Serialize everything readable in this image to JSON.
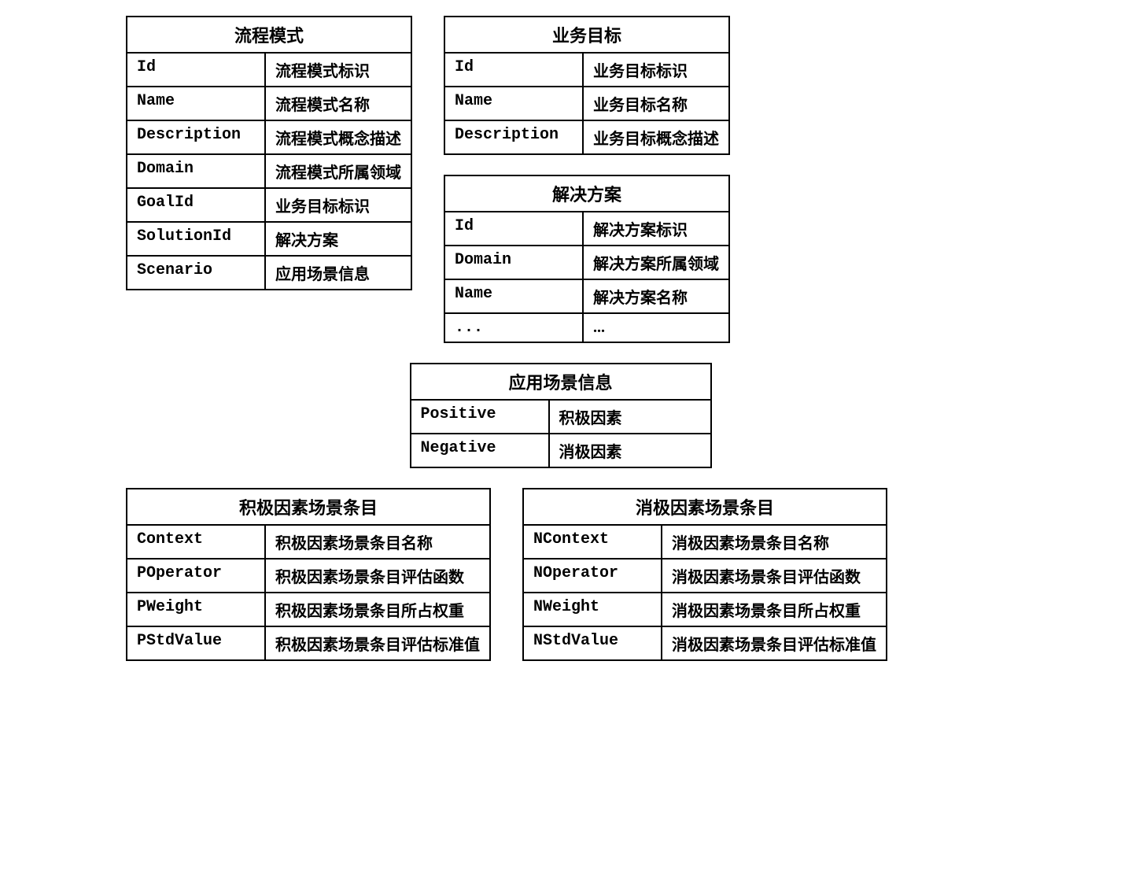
{
  "tables": {
    "process_mode": {
      "title": "流程模式",
      "rows": [
        [
          "Id",
          "流程模式标识"
        ],
        [
          "Name",
          "流程模式名称"
        ],
        [
          "Description",
          "流程模式概念描述"
        ],
        [
          "Domain",
          "流程模式所属领域"
        ],
        [
          "GoalId",
          "业务目标标识"
        ],
        [
          "SolutionId",
          "解决方案"
        ],
        [
          "Scenario",
          "应用场景信息"
        ]
      ]
    },
    "business_goal": {
      "title": "业务目标",
      "rows": [
        [
          "Id",
          "业务目标标识"
        ],
        [
          "Name",
          "业务目标名称"
        ],
        [
          "Description",
          "业务目标概念描述"
        ]
      ]
    },
    "solution": {
      "title": "解决方案",
      "rows": [
        [
          "Id",
          "解决方案标识"
        ],
        [
          "Domain",
          "解决方案所属领域"
        ],
        [
          "Name",
          "解决方案名称"
        ],
        [
          "...",
          "..."
        ]
      ]
    },
    "scenario_info": {
      "title": "应用场景信息",
      "rows": [
        [
          "Positive",
          "积极因素"
        ],
        [
          "Negative",
          "消极因素"
        ]
      ]
    },
    "positive_entry": {
      "title": "积极因素场景条目",
      "rows": [
        [
          "Context",
          "积极因素场景条目名称"
        ],
        [
          "POperator",
          "积极因素场景条目评估函数"
        ],
        [
          "PWeight",
          "积极因素场景条目所占权重"
        ],
        [
          "PStdValue",
          "积极因素场景条目评估标准值"
        ]
      ]
    },
    "negative_entry": {
      "title": "消极因素场景条目",
      "rows": [
        [
          "NContext",
          "消极因素场景条目名称"
        ],
        [
          "NOperator",
          "消极因素场景条目评估函数"
        ],
        [
          "NWeight",
          "消极因素场景条目所占权重"
        ],
        [
          "NStdValue",
          "消极因素场景条目评估标准值"
        ]
      ]
    }
  }
}
